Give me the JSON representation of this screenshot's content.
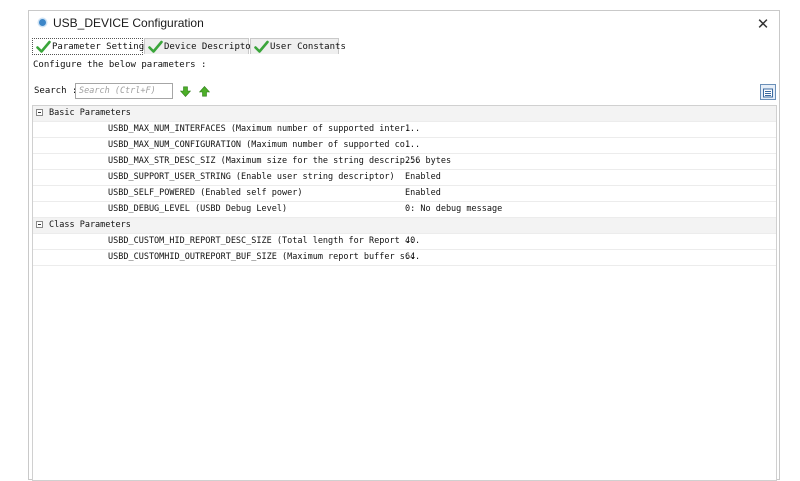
{
  "window": {
    "title": "USB_DEVICE Configuration",
    "close_label": "✕"
  },
  "tabs": [
    {
      "label": "Parameter Settings",
      "active": true
    },
    {
      "label": "Device Descriptor",
      "active": false
    },
    {
      "label": "User Constants",
      "active": false
    }
  ],
  "description": "Configure the below parameters :",
  "search": {
    "label": "Search :",
    "placeholder": "Search (Ctrl+F)"
  },
  "icons": {
    "check": "check-icon",
    "down": "arrow-down-icon",
    "up": "arrow-up-icon",
    "view": "list-view-icon"
  },
  "colors": {
    "check": "#3aa53a",
    "arrow": "#4caf28",
    "title_dot": "#3c86c8"
  },
  "groups": [
    {
      "name": "Basic Parameters",
      "params": [
        {
          "name": "USBD_MAX_NUM_INTERFACES (Maximum number of supported inter...",
          "value": "1"
        },
        {
          "name": "USBD_MAX_NUM_CONFIGURATION (Maximum number of supported co...",
          "value": "1"
        },
        {
          "name": "USBD_MAX_STR_DESC_SIZ (Maximum size for the string descrip...",
          "value": "256 bytes"
        },
        {
          "name": "USBD_SUPPORT_USER_STRING (Enable user string descriptor)",
          "value": "Enabled"
        },
        {
          "name": "USBD_SELF_POWERED (Enabled self power)",
          "value": "Enabled"
        },
        {
          "name": "USBD_DEBUG_LEVEL (USBD Debug Level)",
          "value": "0: No debug message"
        }
      ]
    },
    {
      "name": "Class Parameters",
      "params": [
        {
          "name": "USBD_CUSTOM_HID_REPORT_DESC_SIZE (Total length for Report ...",
          "value": "40"
        },
        {
          "name": "USBD_CUSTOMHID_OUTREPORT_BUF_SIZE (Maximum report buffer s...",
          "value": "64"
        }
      ]
    }
  ]
}
